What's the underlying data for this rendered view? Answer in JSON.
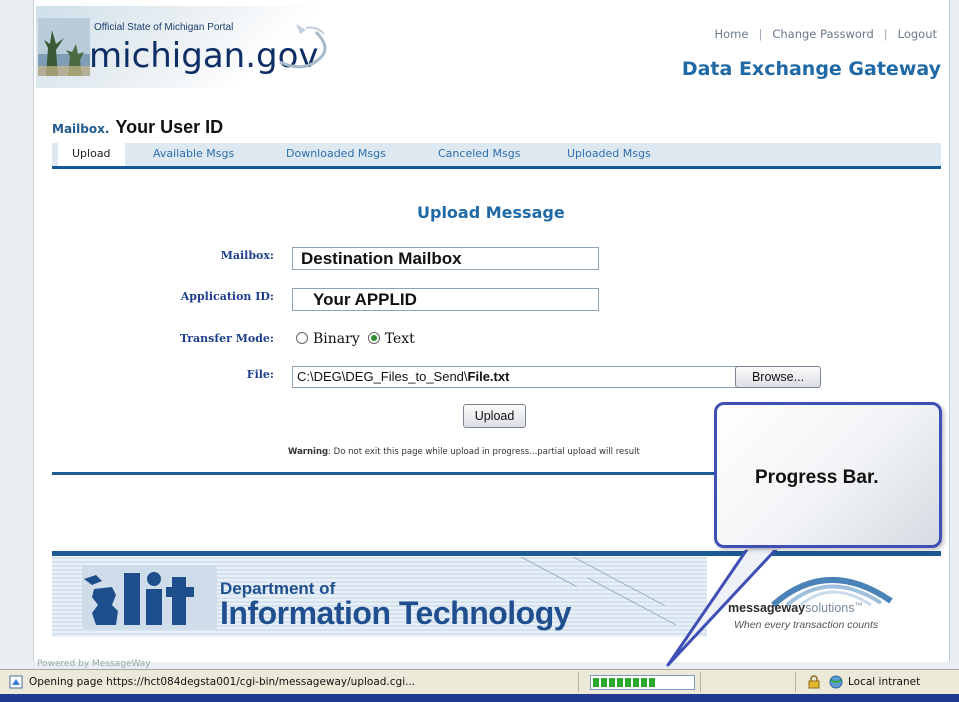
{
  "header": {
    "portal_text": "Official State of Michigan Portal",
    "logo_text": "michigan.gov",
    "links": [
      "Home",
      "Change Password",
      "Logout"
    ],
    "site_title": "Data Exchange Gateway"
  },
  "mailbox": {
    "label": "Mailbox.",
    "user_id": "Your User ID"
  },
  "tabs": [
    "Upload",
    "Available Msgs",
    "Downloaded Msgs",
    "Canceled Msgs",
    "Uploaded Msgs"
  ],
  "form": {
    "title": "Upload Message",
    "mailbox_label": "Mailbox:",
    "mailbox_value": "Destination Mailbox",
    "appid_label": "Application ID:",
    "appid_value": "Your APPLID",
    "mode_label": "Transfer Mode:",
    "mode_options": [
      "Binary",
      "Text"
    ],
    "mode_selected": "Text",
    "file_label": "File:",
    "file_path": "C:\\DEG\\DEG_Files_to_Send\\",
    "file_name": "File.txt",
    "browse_label": "Browse...",
    "upload_label": "Upload",
    "warning_bold": "Warning",
    "warning_text": ": Do not exit this page while upload in progress...partial upload will result"
  },
  "footer": {
    "dept_line1": "Department of",
    "dept_line2": "Information Technology",
    "mw_brand_bold": "messageway",
    "mw_brand_light": "solutions",
    "mw_tm": "™",
    "mw_tagline": "When every transaction counts",
    "powered_text": "Powered by MessageWay"
  },
  "callout": {
    "text": "Progress Bar."
  },
  "statusbar": {
    "text": "Opening page https://hct084degsta001/cgi-bin/messageway/upload.cgi...",
    "progress_segments": 8,
    "zone": "Local intranet"
  },
  "colors": {
    "accent_blue": "#1f6aa6",
    "nav_blue": "#155a94",
    "progress_green": "#2ca82c",
    "callout_border": "#3f4fb5"
  }
}
